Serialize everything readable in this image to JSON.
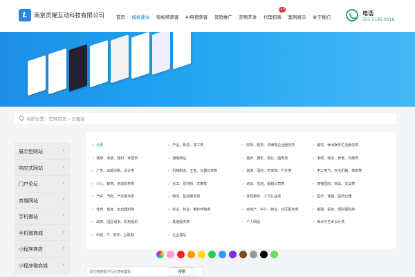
{
  "header": {
    "logo_text": "L",
    "company": "南京灵耀互动科技有限公司",
    "nav": [
      "首页",
      "模板建站",
      "短视频获客",
      "AI电销获客",
      "营销推广",
      "定制开发",
      "代理招商",
      "案例展示",
      "关于我们"
    ],
    "active_index": 1,
    "hot_badge": "HOT",
    "phone_label": "电话",
    "phone_number": "151-5185-0016"
  },
  "breadcrumb": {
    "text": "当前位置：官网首页 › 云建站"
  },
  "sidebar": {
    "items": [
      "展示型网站",
      "响应式网站",
      "门户论坛",
      "商城网站",
      "手机微站",
      "手机微商城",
      "小程序商店",
      "小程序微商城"
    ]
  },
  "categories": {
    "col1": [
      "全部",
      "装修、家装、建材、家居类",
      "广告、出版印刷、设计类",
      "少儿、教育、培训机构类",
      "汽车、汽配、汽车服务类",
      "体育、健身、运动器材类",
      "政府、团区组事、机构组织",
      "科技、IT、软件、互联网"
    ],
    "col2": [
      "产品、制造、加工类",
      "通用网站",
      "机械制造、五金、仪器仪表类",
      "化工、原材料、农畜牧",
      "物流、售后服务类",
      "农业、林业、畜牧养殖类",
      "其他服务类",
      "企业建站"
    ],
    "col3": [
      "财务、税务、法律等企业服务类",
      "婚庆、摄影、婚礼、图表类",
      "旅游、酒店、农家院、户外类",
      "培训、花店、服装公司类",
      "家政服务、工艺礼品类",
      "房地产、中介、物业、社区服务类",
      "个人网站"
    ],
    "col4": [
      "餐饮、休闲娱乐生活服务类",
      "家政、保洁、养老、月嫂类",
      "电工电气、农业机械、高新类",
      "宠物医院、家具、文具类",
      "医疗、保健、医药仪器",
      "金融、投资、理财保险类",
      "美术与艺术设计类"
    ],
    "selected": "全部",
    "check_symbol": "✓"
  },
  "colors": [
    "#ff9ce0",
    "#ff2020",
    "#ff9b00",
    "#ffdd00",
    "#2ecc55",
    "#3399ff",
    "#7a2ee0",
    "#7a4a1a",
    "#999999",
    "#000000",
    "#66dd66"
  ],
  "search": {
    "placeholder": "请在搜索框内行业搜索模板",
    "button": "搜索"
  }
}
